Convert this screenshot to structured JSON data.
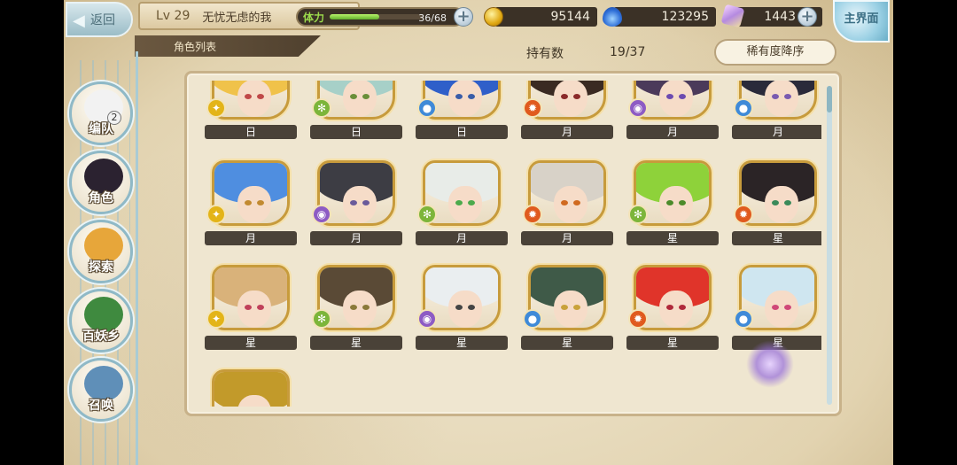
{
  "header": {
    "back_label": "返回",
    "level": "Lv 29",
    "player_name": "无忧无虑的我",
    "list_tab": "角色列表",
    "stamina_label": "体力",
    "stamina_value": "36/68",
    "stamina_fraction": 0.53,
    "gold": "95144",
    "blue_currency": "123295",
    "crystal": "1443",
    "home_label": "主界面"
  },
  "sidebar": {
    "items": [
      {
        "label": "编队",
        "badge": "2",
        "icon": "team-ghost-icon"
      },
      {
        "label": "角色",
        "icon": "character-icon"
      },
      {
        "label": "探索",
        "icon": "explore-icon"
      },
      {
        "label": "百妖乡",
        "icon": "village-icon"
      },
      {
        "label": "召唤",
        "icon": "summon-icon"
      }
    ]
  },
  "list": {
    "owned_label": "持有数",
    "owned_value": "19/37",
    "sort_label": "稀有度降序"
  },
  "colors": {
    "sun": "#e3b418",
    "wind": "#7cb53a",
    "water": "#3f8ad8",
    "fire": "#e05a1e",
    "dark": "#8d5bc4"
  },
  "cards": [
    {
      "attr": "日",
      "element": "sun",
      "hair": "#f0c24a",
      "eye": "#c04848",
      "row": 0
    },
    {
      "attr": "日",
      "element": "wind",
      "hair": "#a7d0c8",
      "eye": "#6a8f3a",
      "row": 0
    },
    {
      "attr": "日",
      "element": "water",
      "hair": "#2f5fc9",
      "eye": "#3a5da8",
      "row": 0
    },
    {
      "attr": "月",
      "element": "fire",
      "hair": "#3a2a22",
      "eye": "#8a2a2a",
      "row": 0
    },
    {
      "attr": "月",
      "element": "dark",
      "hair": "#4b3a5a",
      "eye": "#6d4bb0",
      "row": 0
    },
    {
      "attr": "月",
      "element": "water",
      "hair": "#2a2a3a",
      "eye": "#7a5ab0",
      "row": 0
    },
    {
      "attr": "月",
      "element": "sun",
      "hair": "#4f8ee0",
      "eye": "#c28a30",
      "row": 1
    },
    {
      "attr": "月",
      "element": "dark",
      "hair": "#3d3d44",
      "eye": "#6a5a9a",
      "row": 1
    },
    {
      "attr": "月",
      "element": "wind",
      "hair": "#e8ece8",
      "eye": "#4caa4c",
      "row": 1
    },
    {
      "attr": "月",
      "element": "fire",
      "hair": "#d8d2c8",
      "eye": "#d06a20",
      "row": 1
    },
    {
      "attr": "星",
      "element": "wind",
      "hair": "#8ed23a",
      "eye": "#4c8a2a",
      "row": 1
    },
    {
      "attr": "星",
      "element": "fire",
      "hair": "#2b2426",
      "eye": "#3a8a5a",
      "row": 1
    },
    {
      "attr": "星",
      "element": "sun",
      "hair": "#d9b27a",
      "eye": "#c0405a",
      "row": 2
    },
    {
      "attr": "星",
      "element": "wind",
      "hair": "#5a4a36",
      "eye": "#8a7a3a",
      "row": 2
    },
    {
      "attr": "星",
      "element": "dark",
      "hair": "#eaeef0",
      "eye": "#444",
      "row": 2
    },
    {
      "attr": "星",
      "element": "water",
      "hair": "#3f5a48",
      "eye": "#c9a23a",
      "row": 2
    },
    {
      "attr": "星",
      "element": "fire",
      "hair": "#e0342a",
      "eye": "#b0283a",
      "row": 2
    },
    {
      "attr": "星",
      "element": "water",
      "hair": "#cfe6f0",
      "eye": "#d04878",
      "row": 2
    },
    {
      "attr": "",
      "element": "sun",
      "hair": "#c29a2a",
      "eye": "#6a4a2a",
      "row": 3
    }
  ]
}
